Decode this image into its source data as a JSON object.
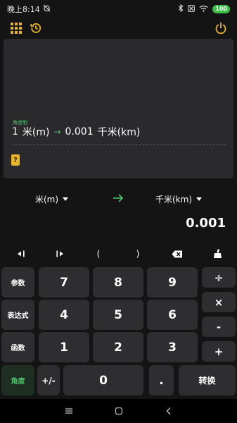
{
  "status_bar": {
    "time": "晚上8:14",
    "battery": "100"
  },
  "colors": {
    "accent_yellow": "#e8b52a",
    "accent_green": "#4cc46a",
    "panel": "#2a2a2c",
    "key": "#2e2e30",
    "background": "#141414"
  },
  "toolbar": {
    "left_icons": [
      "grid-menu-icon",
      "history-icon"
    ],
    "right_icon": "power-icon"
  },
  "display": {
    "mode": "角度制",
    "input_value": "1",
    "input_unit": "米(m)",
    "output_value": "0.001",
    "output_unit": "千米(km)",
    "help_label": "?"
  },
  "converter": {
    "from_unit": "米(m)",
    "to_unit": "千米(km)",
    "result": "0.001"
  },
  "function_row": {
    "cursor_left": "◂|",
    "cursor_right": "|▸",
    "paren_open": "(",
    "paren_close": ")"
  },
  "keypad": {
    "side": [
      "参数",
      "表达式",
      "函数",
      "角度"
    ],
    "digits": [
      "7",
      "8",
      "9",
      "4",
      "5",
      "6",
      "1",
      "2",
      "3",
      "0"
    ],
    "ops": [
      "÷",
      "×",
      "-",
      "+"
    ],
    "plus_minus": "+/-",
    "dot": ".",
    "convert": "转换"
  }
}
